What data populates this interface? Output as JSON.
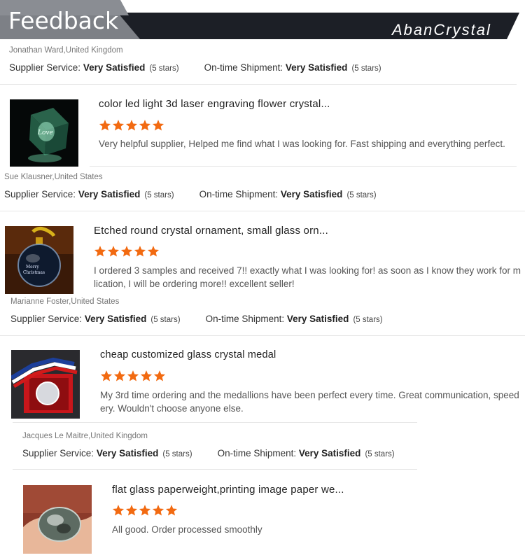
{
  "header": {
    "title": "Feedback",
    "brand": "AbanCrystal"
  },
  "colors": {
    "header_dark": "#1c1f26",
    "header_gray": "#7d8086",
    "star": "#f26a11"
  },
  "labels": {
    "supplier_service": "Supplier Service:",
    "ontime_shipment": "On-time Shipment:"
  },
  "reviews": [
    {
      "reviewer": "Jonathan Ward,United Kingdom",
      "supplier_value": "Very Satisfied",
      "supplier_stars": "(5 stars)",
      "shipment_value": "Very Satisfied",
      "shipment_stars": "(5 stars)"
    },
    {
      "product_title": "color led light 3d laser engraving flower crystal...",
      "rating": 5,
      "comment": "Very helpful supplier, Helped me find what I was looking for. Fast shipping and everything perfect.",
      "thumbnail": "green-crystal-cube-image",
      "reviewer": "Sue Klausner,United States",
      "supplier_value": "Very Satisfied",
      "supplier_stars": "(5 stars)",
      "shipment_value": "Very Satisfied",
      "shipment_stars": "(5 stars)"
    },
    {
      "product_title": "Etched round crystal ornament, small glass orn...",
      "rating": 5,
      "comment_lines": [
        "I ordered 3 samples and received 7!! exactly what I was looking for! as soon as I know they work for m",
        "lication, I will be ordering more!! excellent seller!"
      ],
      "thumbnail": "crystal-ornament-image",
      "reviewer": "Marianne Foster,United States",
      "supplier_value": "Very Satisfied",
      "supplier_stars": "(5 stars)",
      "shipment_value": "Very Satisfied",
      "shipment_stars": "(5 stars)"
    },
    {
      "product_title": "cheap customized glass crystal medal",
      "rating": 5,
      "comment_lines": [
        "My 3rd time ordering and the medallions have been perfect every time.  Great communication, speed",
        "ery.  Wouldn't choose anyone else."
      ],
      "thumbnail": "crystal-medal-image",
      "reviewer": "Jacques Le Maitre,United Kingdom",
      "supplier_value": "Very Satisfied",
      "supplier_stars": "(5 stars)",
      "shipment_value": "Very Satisfied",
      "shipment_stars": "(5 stars)"
    },
    {
      "product_title": "flat glass paperweight,printing image paper we...",
      "rating": 5,
      "comment": "All good. Order processed smoothly",
      "thumbnail": "paperweight-in-hand-image"
    }
  ]
}
